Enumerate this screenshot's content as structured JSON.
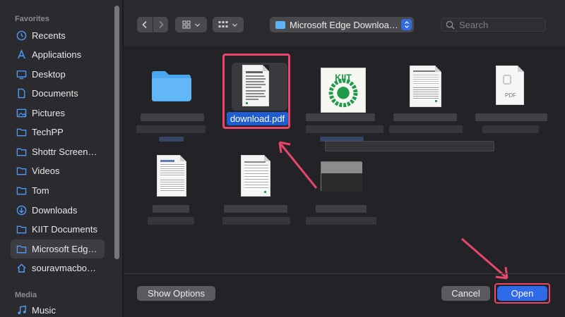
{
  "sidebar": {
    "favorites_heading": "Favorites",
    "media_heading": "Media",
    "items": [
      {
        "label": "Recents",
        "icon": "clock-icon"
      },
      {
        "label": "Applications",
        "icon": "applications-icon"
      },
      {
        "label": "Desktop",
        "icon": "desktop-icon"
      },
      {
        "label": "Documents",
        "icon": "document-icon"
      },
      {
        "label": "Pictures",
        "icon": "pictures-icon"
      },
      {
        "label": "TechPP",
        "icon": "folder-icon"
      },
      {
        "label": "Shottr Screen…",
        "icon": "folder-icon"
      },
      {
        "label": "Videos",
        "icon": "folder-icon"
      },
      {
        "label": "Tom",
        "icon": "folder-icon"
      },
      {
        "label": "Downloads",
        "icon": "downloads-icon"
      },
      {
        "label": "KIIT Documents",
        "icon": "folder-icon"
      },
      {
        "label": "Microsoft Edg…",
        "icon": "folder-icon",
        "active": true
      },
      {
        "label": "souravmacbo…",
        "icon": "home-icon"
      }
    ],
    "media_items": [
      {
        "label": "Music",
        "icon": "music-icon"
      }
    ]
  },
  "toolbar": {
    "location": "Microsoft Edge Downloa…",
    "search_placeholder": "Search"
  },
  "files": {
    "selected_name": "download.pdf",
    "pdf_icon_label": "PDF",
    "kiit_logo_text": "KIIT"
  },
  "footer": {
    "show_options_label": "Show Options",
    "cancel_label": "Cancel",
    "open_label": "Open"
  },
  "colors": {
    "accent": "#2f6ae8",
    "highlight": "#e8466a",
    "folder": "#5fb2f4"
  }
}
